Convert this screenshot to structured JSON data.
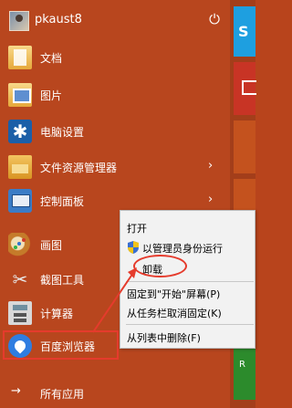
{
  "user": {
    "name": "pkaust8"
  },
  "menu_items": [
    {
      "label": "文档",
      "icon": "documents-folder-icon"
    },
    {
      "label": "图片",
      "icon": "pictures-folder-icon"
    },
    {
      "label": "电脑设置",
      "icon": "settings-gear-icon"
    },
    {
      "label": "文件资源管理器",
      "icon": "file-explorer-icon",
      "arrow": "›"
    },
    {
      "label": "控制面板",
      "icon": "control-panel-icon",
      "arrow": "›"
    },
    {
      "label": "画图",
      "icon": "paint-palette-icon"
    },
    {
      "label": "截图工具",
      "icon": "snipping-tool-icon"
    },
    {
      "label": "计算器",
      "icon": "calculator-icon"
    },
    {
      "label": "百度浏览器",
      "icon": "baidu-browser-icon"
    }
  ],
  "all_apps": {
    "label": "所有应用",
    "arrow": "→"
  },
  "context_menu": {
    "items": [
      {
        "label": "打开"
      },
      {
        "label": "以管理员身份运行"
      },
      {
        "label": "卸载"
      },
      {
        "label": "固定到\"开始\"屏幕(P)"
      },
      {
        "label": "从任务栏取消固定(K)"
      },
      {
        "label": "从列表中删除(F)"
      }
    ]
  },
  "tiles": {
    "skype_letter": "S",
    "green_label": "R"
  },
  "colors": {
    "menu_bg": "#b8461e",
    "annotation_red": "#e53b2c",
    "context_bg": "#f2f2f2"
  }
}
